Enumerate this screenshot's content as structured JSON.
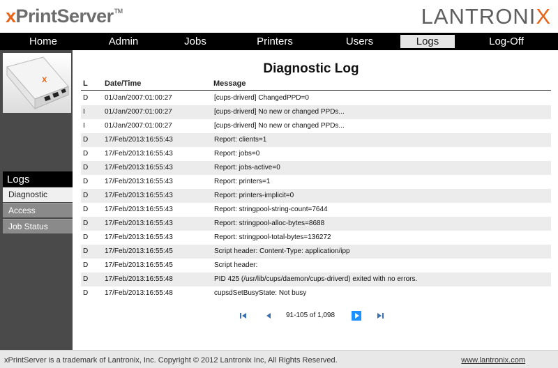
{
  "header": {
    "brand_x": "x",
    "brand_rest": "PrintServer",
    "brand_tm": "TM",
    "company_main": "LANTRONI",
    "company_x": "X"
  },
  "nav": {
    "items": [
      {
        "label": "Home"
      },
      {
        "label": "Admin"
      },
      {
        "label": "Jobs"
      },
      {
        "label": "Printers"
      },
      {
        "label": "Users"
      },
      {
        "label": "Logs"
      },
      {
        "label": "Log-Off"
      }
    ],
    "active": "Logs"
  },
  "sidebar": {
    "device_mark": "X",
    "heading": "Logs",
    "items": [
      {
        "label": "Diagnostic"
      },
      {
        "label": "Access"
      },
      {
        "label": "Job Status"
      }
    ],
    "active": "Diagnostic"
  },
  "main": {
    "title": "Diagnostic Log",
    "columns": {
      "level": "L",
      "datetime": "Date/Time",
      "message": "Message"
    },
    "rows": [
      {
        "level": "D",
        "datetime": "01/Jan/2007:01:00:27",
        "message": "[cups-driverd] ChangedPPD=0"
      },
      {
        "level": "I",
        "datetime": "01/Jan/2007:01:00:27",
        "message": "[cups-driverd] No new or changed PPDs..."
      },
      {
        "level": "I",
        "datetime": "01/Jan/2007:01:00:27",
        "message": "[cups-driverd] No new or changed PPDs..."
      },
      {
        "level": "D",
        "datetime": "17/Feb/2013:16:55:43",
        "message": "Report: clients=1"
      },
      {
        "level": "D",
        "datetime": "17/Feb/2013:16:55:43",
        "message": "Report: jobs=0"
      },
      {
        "level": "D",
        "datetime": "17/Feb/2013:16:55:43",
        "message": "Report: jobs-active=0"
      },
      {
        "level": "D",
        "datetime": "17/Feb/2013:16:55:43",
        "message": "Report: printers=1"
      },
      {
        "level": "D",
        "datetime": "17/Feb/2013:16:55:43",
        "message": "Report: printers-implicit=0"
      },
      {
        "level": "D",
        "datetime": "17/Feb/2013:16:55:43",
        "message": "Report: stringpool-string-count=7644"
      },
      {
        "level": "D",
        "datetime": "17/Feb/2013:16:55:43",
        "message": "Report: stringpool-alloc-bytes=8688"
      },
      {
        "level": "D",
        "datetime": "17/Feb/2013:16:55:43",
        "message": "Report: stringpool-total-bytes=136272"
      },
      {
        "level": "D",
        "datetime": "17/Feb/2013:16:55:45",
        "message": "Script header: Content-Type: application/ipp"
      },
      {
        "level": "D",
        "datetime": "17/Feb/2013:16:55:45",
        "message": "Script header:"
      },
      {
        "level": "D",
        "datetime": "17/Feb/2013:16:55:48",
        "message": "PID 425 (/usr/lib/cups/daemon/cups-driverd) exited with no errors."
      },
      {
        "level": "D",
        "datetime": "17/Feb/2013:16:55:48",
        "message": "cupsdSetBusyState: Not busy"
      }
    ],
    "pager": {
      "range": "91-105 of 1,098"
    }
  },
  "footer": {
    "copyright": "xPrintServer is a trademark of Lantronix, Inc. Copyright © 2012 Lantronix Inc, All Rights Reserved.",
    "link": "www.lantronix.com"
  },
  "colors": {
    "accent": "#e8641a",
    "pager_next": "#1e90ff",
    "pager_icon": "#3a6fb0"
  },
  "icons": [
    "first-page-icon",
    "prev-page-icon",
    "next-page-icon",
    "last-page-icon"
  ]
}
